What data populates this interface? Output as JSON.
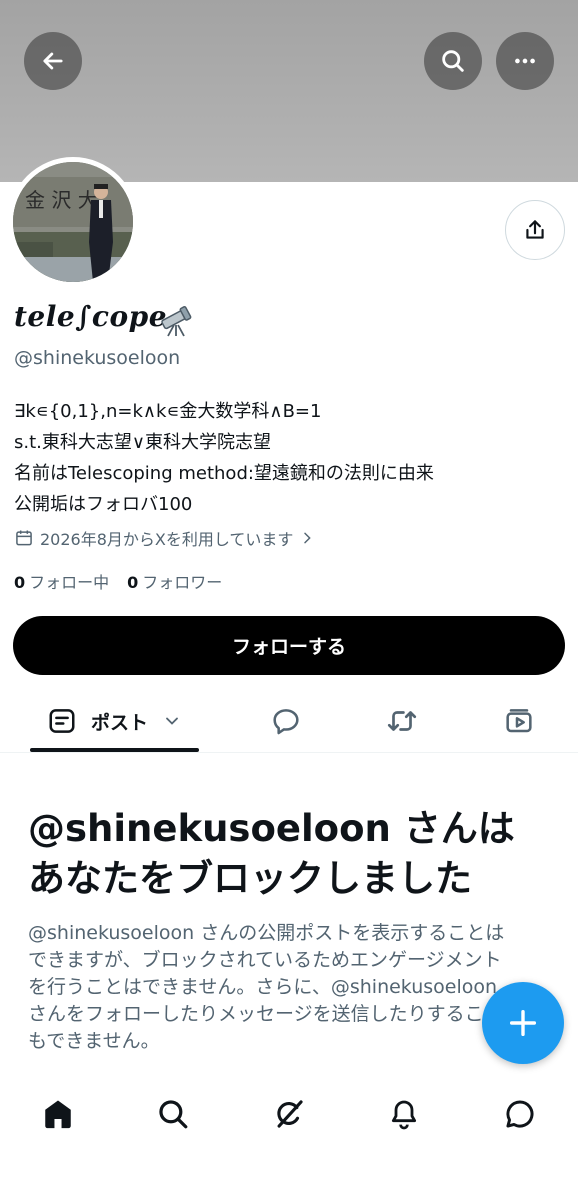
{
  "header": {
    "back_icon": "arrow-left-icon",
    "search_icon": "search-icon",
    "more_icon": "more-horizontal-icon"
  },
  "profile": {
    "display_name": "tele∫cope",
    "display_emoji": "telescope-emoji",
    "handle": "@shinekusoeloon",
    "bio": [
      "∃k∊{0,1},n=k∧k∊金大数学科∧B=1",
      "s.t.東科大志望∨東科大学院志望",
      "名前はTelescoping method:望遠鏡和の法則に由来",
      "公開垢はフォロバ100"
    ],
    "joined": "2026年8月からXを利用しています",
    "following_count": "0",
    "following_label": "フォロー中",
    "followers_count": "0",
    "followers_label": "フォロワー",
    "follow_button": "フォローする"
  },
  "tabs": {
    "posts_label": "ポスト",
    "icons": [
      "post-icon",
      "reply-icon",
      "repost-icon",
      "media-icon"
    ]
  },
  "blocked": {
    "title": [
      "@shinekusoeloon さんは",
      "あなたをブロックしました"
    ],
    "body": [
      "@shinekusoeloon さんの公開ポストを表示することは",
      "できますが、ブロックされているためエンゲージメント",
      "を行うことはできません。さらに、@shinekusoeloon",
      "さんをフォローしたりメッセージを送信したりすること",
      "もできません。"
    ]
  },
  "bottom_nav": [
    "home-icon",
    "explore-icon",
    "grok-icon",
    "notifications-icon",
    "messages-icon"
  ],
  "colors": {
    "accent": "#1d9bf0",
    "text": "#0f1419",
    "secondary": "#536471"
  }
}
